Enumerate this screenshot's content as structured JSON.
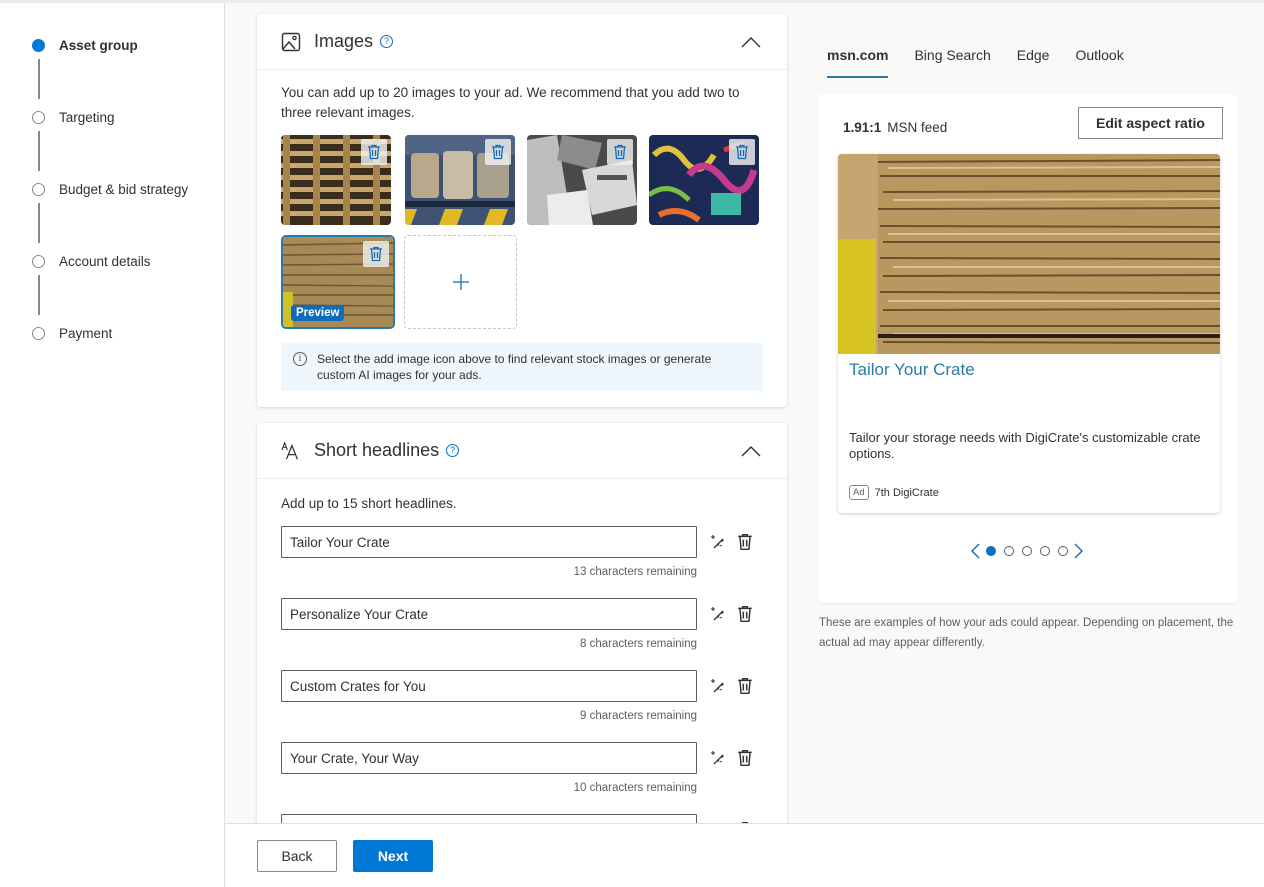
{
  "stepper": {
    "steps": [
      {
        "label": "Asset group",
        "state": "active"
      },
      {
        "label": "Targeting",
        "state": "pending"
      },
      {
        "label": "Budget & bid strategy",
        "state": "pending"
      },
      {
        "label": "Account details",
        "state": "pending"
      },
      {
        "label": "Payment",
        "state": "pending"
      }
    ]
  },
  "images_section": {
    "title": "Images",
    "description": "You can add up to 20 images to your ad. We recommend that you add two to three relevant images.",
    "thumbnails": [
      {
        "subject": "stacked wooden pallets",
        "selected": false
      },
      {
        "subject": "compressed cardboard bales",
        "selected": false
      },
      {
        "subject": "black and white posters",
        "selected": false
      },
      {
        "subject": "colorful graffiti wall",
        "selected": false
      },
      {
        "subject": "stacked cardboard sheets",
        "selected": true
      }
    ],
    "preview_badge": "Preview",
    "info_text": "Select the add image icon above to find relevant stock images or generate custom AI images for your ads."
  },
  "headlines_section": {
    "title": "Short headlines",
    "description": "Add up to 15 short headlines.",
    "items": [
      {
        "value": "Tailor Your Crate",
        "remaining": "13 characters remaining"
      },
      {
        "value": "Personalize Your Crate",
        "remaining": "8 characters remaining"
      },
      {
        "value": "Custom Crates for You",
        "remaining": "9 characters remaining"
      },
      {
        "value": "Your Crate, Your Way",
        "remaining": "10 characters remaining"
      },
      {
        "value": "",
        "remaining": ""
      }
    ]
  },
  "footer": {
    "back_label": "Back",
    "next_label": "Next"
  },
  "preview": {
    "tabs": [
      {
        "label": "msn.com",
        "active": true
      },
      {
        "label": "Bing Search",
        "active": false
      },
      {
        "label": "Edge",
        "active": false
      },
      {
        "label": "Outlook",
        "active": false
      }
    ],
    "ratio": "1.91:1",
    "format_name": "MSN feed",
    "edit_ratio_label": "Edit aspect ratio",
    "ad": {
      "headline": "Tailor Your Crate",
      "description": "Tailor your storage needs with DigiCrate's customizable crate options.",
      "badge": "Ad",
      "advertiser": "7th DigiCrate"
    },
    "carousel": {
      "total": 5,
      "current": 1
    },
    "note": "These are examples of how your ads could appear. Depending on placement, the actual ad may appear differently."
  },
  "colors": {
    "accent": "#0078d4",
    "link": "#2b7aa6",
    "info_bg": "#eff6fc",
    "page_bg": "#faf9f8"
  }
}
